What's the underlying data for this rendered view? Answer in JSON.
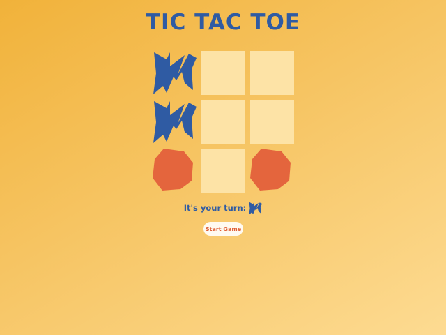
{
  "title": "TIC TAC TOE",
  "board": {
    "cells": [
      "x",
      "",
      "",
      "x",
      "",
      "",
      "o",
      "",
      "o"
    ]
  },
  "turn": {
    "label": "It's your turn:",
    "current_player": "x"
  },
  "start_button": {
    "label": "Start Game"
  },
  "colors": {
    "x_mark": "#2f5ba3",
    "o_mark": "#e4653d",
    "empty_cell": "#fde3a6",
    "title_text": "#2f5ba3",
    "button_text": "#e05f35",
    "button_bg": "#fffaf0"
  },
  "icons": {
    "x": "jagged-blue-x-icon",
    "o": "orange-octagon-o-icon"
  }
}
